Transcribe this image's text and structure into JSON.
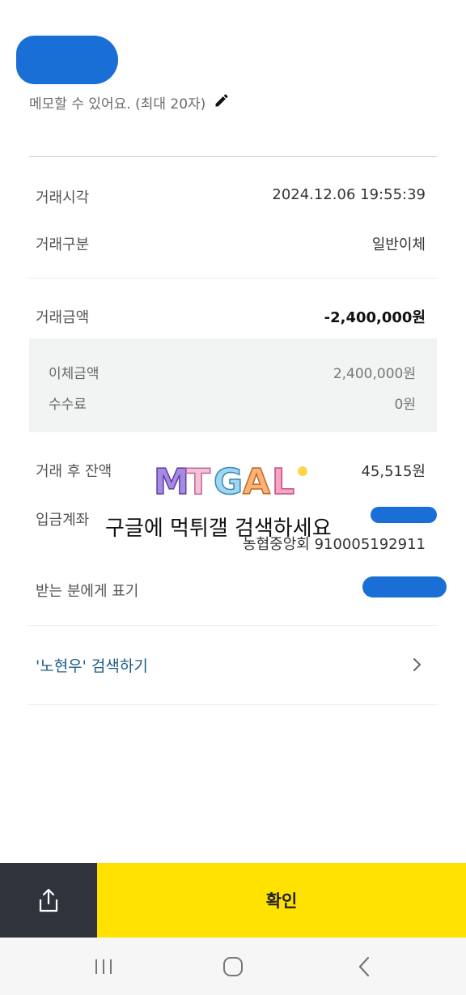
{
  "memo": {
    "hint": "메모할 수 있어요. (최대 20자)",
    "edit_icon": "pencil-icon"
  },
  "details": {
    "time": {
      "label": "거래시각",
      "value": "2024.12.06 19:55:39"
    },
    "type": {
      "label": "거래구분",
      "value": "일반이체"
    },
    "amount": {
      "label": "거래금액",
      "value": "-2,400,000원"
    },
    "transfer": {
      "label": "이체금액",
      "value": "2,400,000원"
    },
    "fee": {
      "label": "수수료",
      "value": "0원"
    },
    "balance": {
      "label": "거래 후 잔액",
      "value": "45,515원"
    },
    "deposit_account": {
      "label": "입금계좌",
      "value": "농협중앙회 910005192911"
    },
    "recipient_display": {
      "label": "받는 분에게 표기"
    }
  },
  "search": {
    "label": "'노현우' 검색하기"
  },
  "watermark": {
    "logo_text": "MTGAL",
    "overlay_text": "구글에 먹튀갤 검색하세요"
  },
  "bottom": {
    "confirm_label": "확인",
    "share_icon": "share-icon"
  },
  "colors": {
    "accent_yellow": "#ffe200",
    "dark_button": "#2f343c",
    "link_blue": "#1e5c86",
    "redaction_blue": "#1a6fd6"
  }
}
